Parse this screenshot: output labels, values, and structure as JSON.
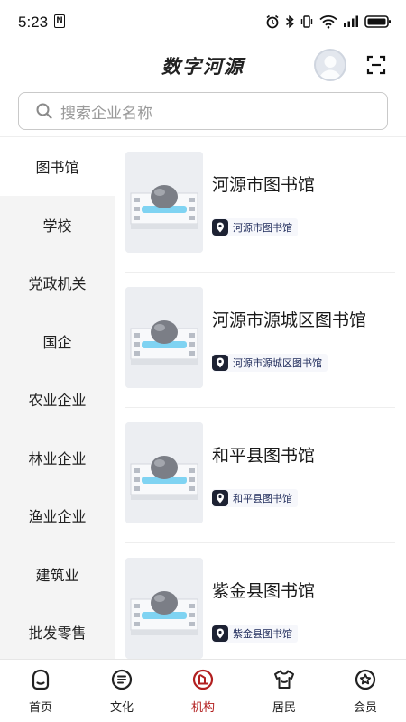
{
  "status_bar": {
    "time": "5:23",
    "n_badge": "N"
  },
  "header": {
    "title": "数字河源"
  },
  "search": {
    "placeholder": "搜索企业名称"
  },
  "sidebar": {
    "items": [
      {
        "label": "图书馆",
        "active": true
      },
      {
        "label": "学校"
      },
      {
        "label": "党政机关"
      },
      {
        "label": "国企"
      },
      {
        "label": "农业企业"
      },
      {
        "label": "林业企业"
      },
      {
        "label": "渔业企业"
      },
      {
        "label": "建筑业"
      },
      {
        "label": "批发零售"
      }
    ]
  },
  "list": {
    "items": [
      {
        "title": "河源市图书馆",
        "tag": "河源市图书馆"
      },
      {
        "title": "河源市源城区图书馆",
        "tag": "河源市源城区图书馆"
      },
      {
        "title": "和平县图书馆",
        "tag": "和平县图书馆"
      },
      {
        "title": "紫金县图书馆",
        "tag": "紫金县图书馆"
      }
    ]
  },
  "bottom_nav": {
    "items": [
      {
        "label": "首页",
        "icon": "home-icon"
      },
      {
        "label": "文化",
        "icon": "culture-icon"
      },
      {
        "label": "机构",
        "icon": "institution-icon",
        "active": true
      },
      {
        "label": "居民",
        "icon": "resident-icon"
      },
      {
        "label": "会员",
        "icon": "member-icon"
      }
    ]
  },
  "colors": {
    "accent": "#b21f1f",
    "sidebar_bg": "#f4f4f4",
    "tag_bg": "#f6f7fb",
    "tag_text": "#1e2a5a"
  }
}
